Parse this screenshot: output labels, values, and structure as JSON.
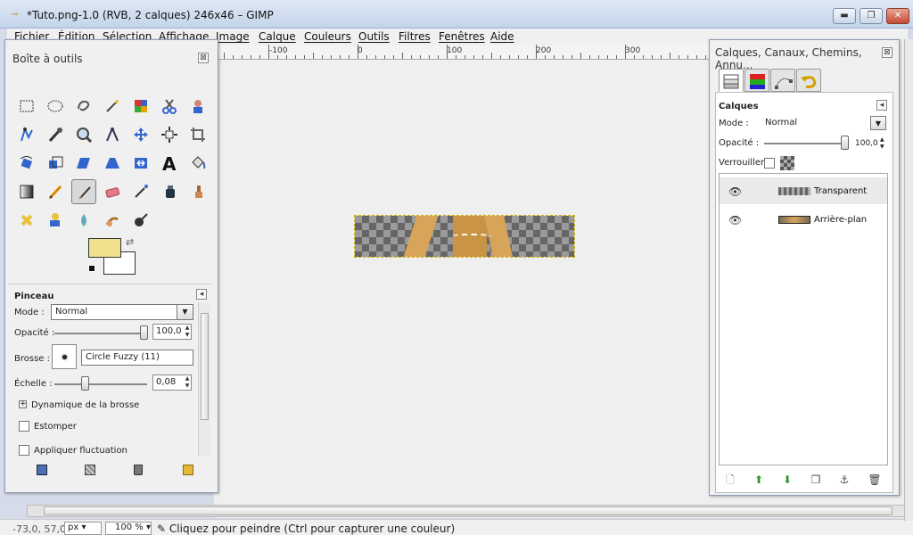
{
  "window": {
    "title": "*Tuto.png-1.0 (RVB, 2 calques) 246x46 – GIMP",
    "buttons": [
      "▬",
      "❐",
      "✕"
    ]
  },
  "menu": {
    "items": [
      "Fichier",
      "Édition",
      "Sélection",
      "Affichage",
      "Image",
      "Calque",
      "Couleurs",
      "Outils",
      "Filtres",
      "Fenêtres",
      "Aide"
    ]
  },
  "ruler": {
    "labels": [
      "-100",
      "0",
      "100",
      "200",
      "300"
    ]
  },
  "toolbox": {
    "title": "Boîte à outils",
    "close": "⊠",
    "tools": [
      "rect-select",
      "ellipse-select",
      "free-select",
      "fuzzy-select",
      "color-select",
      "scissors-select",
      "foreground-select",
      "paths",
      "color-picker",
      "zoom",
      "measure",
      "move",
      "align",
      "crop",
      "rotate",
      "scale",
      "shear",
      "perspective",
      "flip",
      "text",
      "bucket-fill",
      "blend",
      "pencil",
      "paintbrush",
      "eraser",
      "airbrush",
      "ink",
      "clone",
      "heal",
      "perspective-clone",
      "blur",
      "smudge",
      "dodge-burn"
    ],
    "colors": {
      "foreground": "#f0e18e",
      "background": "#ffffff"
    },
    "options": {
      "title": "Pinceau",
      "mode_label": "Mode :",
      "mode_value": "Normal",
      "opacity_label": "Opacité :",
      "opacity_value": "100,0",
      "brush_label": "Brosse :",
      "brush_value": "Circle Fuzzy (11)",
      "scale_label": "Échelle :",
      "scale_value": "0,08",
      "dynamics_label": "Dynamique de la brosse",
      "fade_label": "Estomper",
      "jitter_label": "Appliquer fluctuation"
    }
  },
  "dock": {
    "title": "Calques, Canaux, Chemins, Annu...",
    "close": "⊠",
    "tabs": [
      "layers-icon",
      "channels-icon",
      "paths-icon",
      "undo-icon"
    ],
    "section_title": "Calques",
    "mode_label": "Mode :",
    "mode_value": "Normal",
    "opacity_label": "Opacité :",
    "opacity_value": "100,0",
    "lock_label": "Verrouiller :",
    "layers": [
      {
        "name": "Transparent",
        "selected": true
      },
      {
        "name": "Arrière-plan",
        "selected": false
      }
    ]
  },
  "status": {
    "coords": "-73,0, 57,0",
    "unit": "px",
    "zoom": "100 %",
    "message": "Cliquez pour peindre (Ctrl pour capturer une couleur)"
  }
}
